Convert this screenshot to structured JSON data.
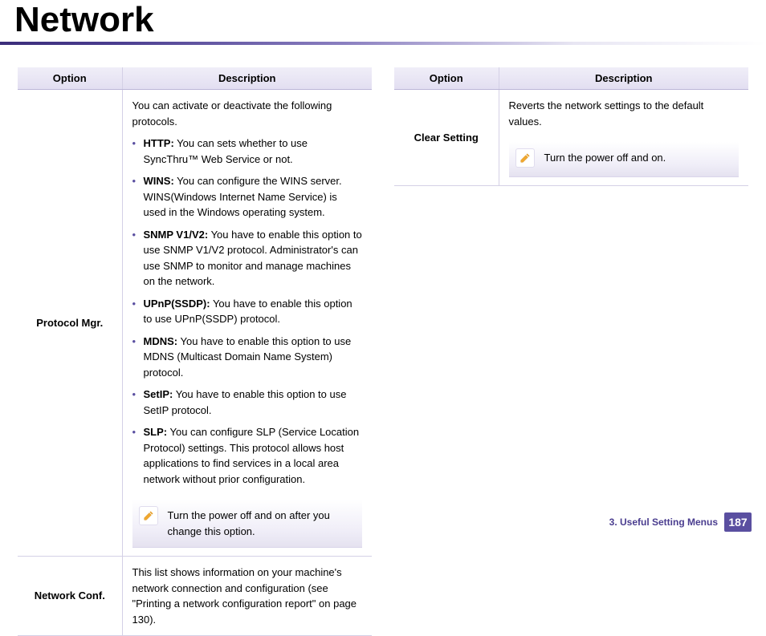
{
  "page_title": "Network",
  "headers": {
    "option": "Option",
    "description": "Description"
  },
  "left_rows": {
    "protocol_mgr": {
      "option": "Protocol Mgr.",
      "intro": "You can activate or deactivate the following protocols.",
      "items": [
        {
          "name": "HTTP:",
          "text": "  You can sets whether to use SyncThru™ Web Service or not."
        },
        {
          "name": "WINS:",
          "text": "  You can configure the WINS server. WINS(Windows Internet Name Service) is used in the Windows operating system."
        },
        {
          "name": "SNMP V1/V2:",
          "text": " You have to enable this option to use SNMP V1/V2 protocol. Administrator's can use SNMP to monitor and manage machines on the network."
        },
        {
          "name": "UPnP(SSDP):",
          "text": " You have to enable this option to use UPnP(SSDP) protocol."
        },
        {
          "name": "MDNS:",
          "text": " You have to enable this option to use MDNS (Multicast Domain Name System) protocol."
        },
        {
          "name": "SetIP:",
          "text": " You have to enable this option to use SetIP protocol."
        },
        {
          "name": "SLP:",
          "text": " You can configure SLP (Service Location Protocol) settings. This protocol allows host applications to find services in a local area network without prior configuration."
        }
      ],
      "note": "Turn the power off and on after you change this option."
    },
    "network_conf": {
      "option": "Network Conf.",
      "desc": "This list shows information on your machine's network connection and configuration (see \"Printing a network configuration report\" on page 130)."
    }
  },
  "right_rows": {
    "clear_setting": {
      "option": "Clear Setting",
      "desc": "Reverts the network settings to the default values.",
      "note": "Turn the power off and on."
    }
  },
  "footer": {
    "section": "3.  Useful Setting Menus",
    "page": "187"
  }
}
